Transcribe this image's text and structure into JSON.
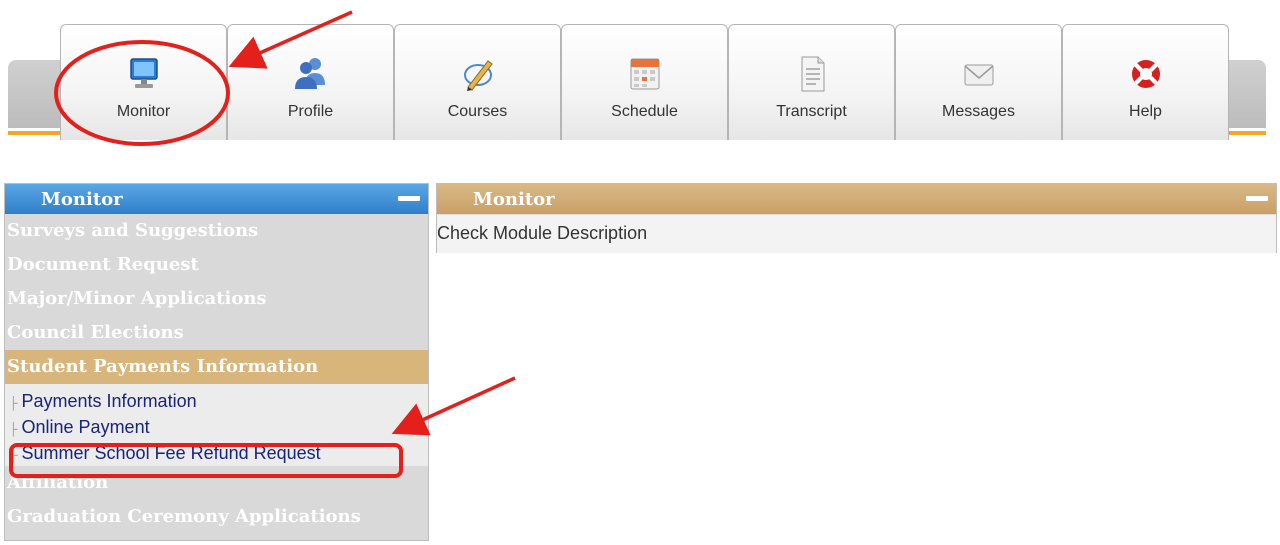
{
  "tabs": [
    {
      "label": "Monitor",
      "icon": "monitor-icon"
    },
    {
      "label": "Profile",
      "icon": "users-icon"
    },
    {
      "label": "Courses",
      "icon": "pencil-icon"
    },
    {
      "label": "Schedule",
      "icon": "calendar-icon"
    },
    {
      "label": "Transcript",
      "icon": "document-icon"
    },
    {
      "label": "Messages",
      "icon": "envelope-icon"
    },
    {
      "label": "Help",
      "icon": "lifebuoy-icon"
    }
  ],
  "left_panel": {
    "title": "Monitor",
    "items": [
      {
        "label": "Surveys and Suggestions"
      },
      {
        "label": "Document Request"
      },
      {
        "label": "Major/Minor Applications"
      },
      {
        "label": "Council Elections"
      },
      {
        "label": "Student Payments Information",
        "active": true,
        "children": [
          {
            "label": "Payments Information"
          },
          {
            "label": "Online Payment"
          },
          {
            "label": "Summer School Fee Refund Request"
          }
        ]
      },
      {
        "label": "Affiliation"
      },
      {
        "label": "Graduation Ceremony Applications"
      }
    ]
  },
  "right_panel": {
    "title": "Monitor",
    "description": "Check Module Description"
  },
  "colors": {
    "left_header": "#3f8fd8",
    "right_header": "#d2ae75",
    "active_menu": "#d8b57b",
    "menu_bg": "#d9d9d9",
    "sub_link": "#1a237e",
    "annotation": "#e3201b",
    "tab_accent": "#f5a623"
  }
}
